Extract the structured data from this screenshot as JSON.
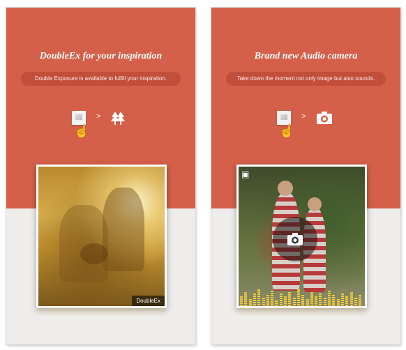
{
  "screens": [
    {
      "title": "DoubleEx for your inspiration",
      "subtitle": "Double Exposure is available to fulfill your inspiration.",
      "photo_label": "DoubleEx",
      "icons": [
        "photo-thumbnail-icon",
        "tap-hand-icon",
        "arrow-right-icon",
        "trees-icon"
      ]
    },
    {
      "title": "Brand new Audio camera",
      "subtitle": "Take down the moment not only image but also sounds.",
      "icons": [
        "photo-thumbnail-icon",
        "tap-hand-icon",
        "arrow-right-icon",
        "camera-icon"
      ]
    }
  ],
  "colors": {
    "band": "#d4604a",
    "pill": "#c24f3c",
    "background": "#efedeb",
    "equalizer": "#f0c93a"
  }
}
